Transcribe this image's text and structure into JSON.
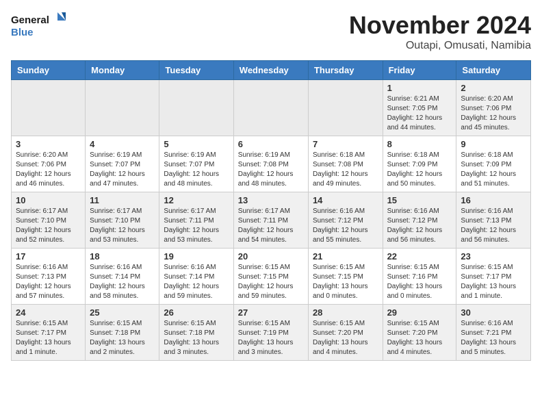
{
  "header": {
    "logo_line1": "General",
    "logo_line2": "Blue",
    "month_title": "November 2024",
    "location": "Outapi, Omusati, Namibia"
  },
  "days_of_week": [
    "Sunday",
    "Monday",
    "Tuesday",
    "Wednesday",
    "Thursday",
    "Friday",
    "Saturday"
  ],
  "weeks": [
    [
      {
        "day": "",
        "info": ""
      },
      {
        "day": "",
        "info": ""
      },
      {
        "day": "",
        "info": ""
      },
      {
        "day": "",
        "info": ""
      },
      {
        "day": "",
        "info": ""
      },
      {
        "day": "1",
        "info": "Sunrise: 6:21 AM\nSunset: 7:05 PM\nDaylight: 12 hours\nand 44 minutes."
      },
      {
        "day": "2",
        "info": "Sunrise: 6:20 AM\nSunset: 7:06 PM\nDaylight: 12 hours\nand 45 minutes."
      }
    ],
    [
      {
        "day": "3",
        "info": "Sunrise: 6:20 AM\nSunset: 7:06 PM\nDaylight: 12 hours\nand 46 minutes."
      },
      {
        "day": "4",
        "info": "Sunrise: 6:19 AM\nSunset: 7:07 PM\nDaylight: 12 hours\nand 47 minutes."
      },
      {
        "day": "5",
        "info": "Sunrise: 6:19 AM\nSunset: 7:07 PM\nDaylight: 12 hours\nand 48 minutes."
      },
      {
        "day": "6",
        "info": "Sunrise: 6:19 AM\nSunset: 7:08 PM\nDaylight: 12 hours\nand 48 minutes."
      },
      {
        "day": "7",
        "info": "Sunrise: 6:18 AM\nSunset: 7:08 PM\nDaylight: 12 hours\nand 49 minutes."
      },
      {
        "day": "8",
        "info": "Sunrise: 6:18 AM\nSunset: 7:09 PM\nDaylight: 12 hours\nand 50 minutes."
      },
      {
        "day": "9",
        "info": "Sunrise: 6:18 AM\nSunset: 7:09 PM\nDaylight: 12 hours\nand 51 minutes."
      }
    ],
    [
      {
        "day": "10",
        "info": "Sunrise: 6:17 AM\nSunset: 7:10 PM\nDaylight: 12 hours\nand 52 minutes."
      },
      {
        "day": "11",
        "info": "Sunrise: 6:17 AM\nSunset: 7:10 PM\nDaylight: 12 hours\nand 53 minutes."
      },
      {
        "day": "12",
        "info": "Sunrise: 6:17 AM\nSunset: 7:11 PM\nDaylight: 12 hours\nand 53 minutes."
      },
      {
        "day": "13",
        "info": "Sunrise: 6:17 AM\nSunset: 7:11 PM\nDaylight: 12 hours\nand 54 minutes."
      },
      {
        "day": "14",
        "info": "Sunrise: 6:16 AM\nSunset: 7:12 PM\nDaylight: 12 hours\nand 55 minutes."
      },
      {
        "day": "15",
        "info": "Sunrise: 6:16 AM\nSunset: 7:12 PM\nDaylight: 12 hours\nand 56 minutes."
      },
      {
        "day": "16",
        "info": "Sunrise: 6:16 AM\nSunset: 7:13 PM\nDaylight: 12 hours\nand 56 minutes."
      }
    ],
    [
      {
        "day": "17",
        "info": "Sunrise: 6:16 AM\nSunset: 7:13 PM\nDaylight: 12 hours\nand 57 minutes."
      },
      {
        "day": "18",
        "info": "Sunrise: 6:16 AM\nSunset: 7:14 PM\nDaylight: 12 hours\nand 58 minutes."
      },
      {
        "day": "19",
        "info": "Sunrise: 6:16 AM\nSunset: 7:14 PM\nDaylight: 12 hours\nand 59 minutes."
      },
      {
        "day": "20",
        "info": "Sunrise: 6:15 AM\nSunset: 7:15 PM\nDaylight: 12 hours\nand 59 minutes."
      },
      {
        "day": "21",
        "info": "Sunrise: 6:15 AM\nSunset: 7:15 PM\nDaylight: 13 hours\nand 0 minutes."
      },
      {
        "day": "22",
        "info": "Sunrise: 6:15 AM\nSunset: 7:16 PM\nDaylight: 13 hours\nand 0 minutes."
      },
      {
        "day": "23",
        "info": "Sunrise: 6:15 AM\nSunset: 7:17 PM\nDaylight: 13 hours\nand 1 minute."
      }
    ],
    [
      {
        "day": "24",
        "info": "Sunrise: 6:15 AM\nSunset: 7:17 PM\nDaylight: 13 hours\nand 1 minute."
      },
      {
        "day": "25",
        "info": "Sunrise: 6:15 AM\nSunset: 7:18 PM\nDaylight: 13 hours\nand 2 minutes."
      },
      {
        "day": "26",
        "info": "Sunrise: 6:15 AM\nSunset: 7:18 PM\nDaylight: 13 hours\nand 3 minutes."
      },
      {
        "day": "27",
        "info": "Sunrise: 6:15 AM\nSunset: 7:19 PM\nDaylight: 13 hours\nand 3 minutes."
      },
      {
        "day": "28",
        "info": "Sunrise: 6:15 AM\nSunset: 7:20 PM\nDaylight: 13 hours\nand 4 minutes."
      },
      {
        "day": "29",
        "info": "Sunrise: 6:15 AM\nSunset: 7:20 PM\nDaylight: 13 hours\nand 4 minutes."
      },
      {
        "day": "30",
        "info": "Sunrise: 6:16 AM\nSunset: 7:21 PM\nDaylight: 13 hours\nand 5 minutes."
      }
    ]
  ]
}
